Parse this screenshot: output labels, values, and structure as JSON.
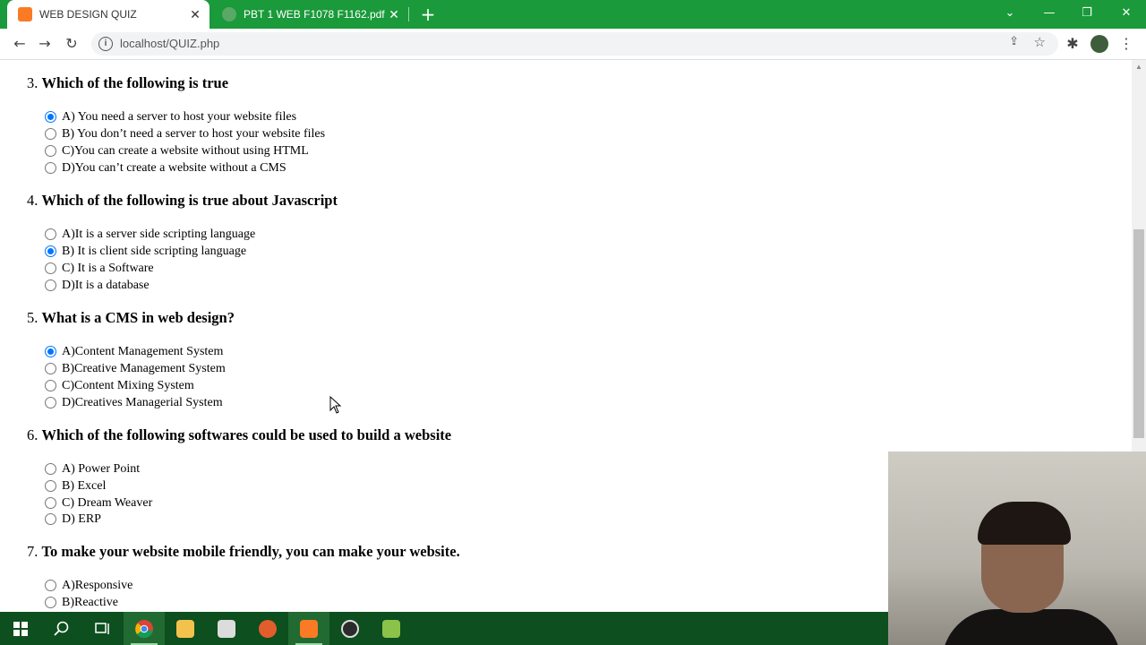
{
  "browser": {
    "tabs": [
      {
        "title": "WEB DESIGN QUIZ",
        "active": true,
        "icon": "xampp-icon"
      },
      {
        "title": "PBT 1 WEB F1078 F1162.pdf",
        "active": false,
        "icon": "globe-icon"
      }
    ],
    "new_tab_glyph": "+",
    "address": "localhost/QUIZ.php",
    "colors": {
      "tabstrip": "#1a9a3a",
      "taskbar": "#0d4f1e",
      "radio_accent": "#0075ff"
    }
  },
  "quiz": {
    "questions": [
      {
        "number": "3.",
        "text": "Which of the following is true",
        "options": [
          {
            "label": "A) You need a server to host your website files",
            "checked": true
          },
          {
            "label": "B) You don’t need a server to host your website files",
            "checked": false
          },
          {
            "label": "C)You can create a website without using HTML",
            "checked": false
          },
          {
            "label": "D)You can’t create a website without a CMS",
            "checked": false
          }
        ]
      },
      {
        "number": "4.",
        "text": "Which of the following is true about Javascript",
        "options": [
          {
            "label": "A)It is a server side scripting language",
            "checked": false
          },
          {
            "label": "B) It is client side scripting language",
            "checked": true
          },
          {
            "label": "C) It is a Software",
            "checked": false
          },
          {
            "label": "D)It is a database",
            "checked": false
          }
        ]
      },
      {
        "number": "5.",
        "text": "What is a CMS in web design?",
        "options": [
          {
            "label": "A)Content Management System",
            "checked": true
          },
          {
            "label": "B)Creative Management System",
            "checked": false
          },
          {
            "label": "C)Content Mixing System",
            "checked": false
          },
          {
            "label": "D)Creatives Managerial System",
            "checked": false
          }
        ]
      },
      {
        "number": "6.",
        "text": "Which of the following softwares could be used to build a website",
        "options": [
          {
            "label": "A) Power Point",
            "checked": false
          },
          {
            "label": "B) Excel",
            "checked": false
          },
          {
            "label": "C) Dream Weaver",
            "checked": false
          },
          {
            "label": "D) ERP",
            "checked": false
          }
        ]
      },
      {
        "number": "7.",
        "text": "To make your website mobile friendly, you can make your website.",
        "options": [
          {
            "label": "A)Responsive",
            "checked": false
          },
          {
            "label": "B)Reactive",
            "checked": false
          }
        ]
      }
    ]
  },
  "taskbar": {
    "items": [
      "windows-start-icon",
      "search-icon",
      "task-view-icon",
      "chrome-icon",
      "file-explorer-icon",
      "microsoft-store-icon",
      "media-player-icon",
      "xampp-icon",
      "obs-icon",
      "notepad-plus-plus-icon"
    ]
  }
}
